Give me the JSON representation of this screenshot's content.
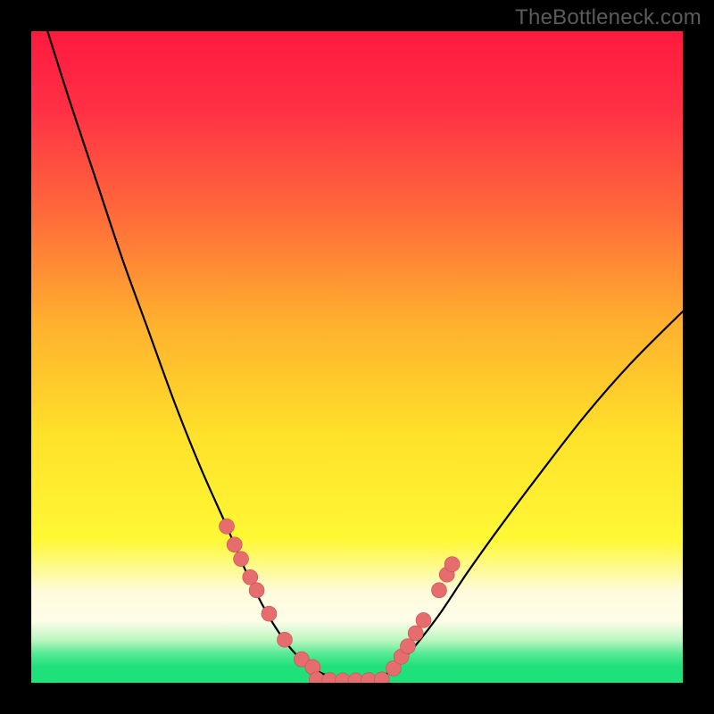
{
  "watermark": "TheBottleneck.com",
  "colors": {
    "black": "#000000",
    "curve": "#000000",
    "dot_fill": "#e56d6d",
    "dot_stroke": "#c94f4f",
    "green_band": "#1fe27b",
    "band_highlight": "#fefbdc"
  },
  "chart_data": {
    "type": "line",
    "title": "",
    "xlabel": "",
    "ylabel": "",
    "xlim": [
      0,
      100
    ],
    "ylim": [
      0,
      100
    ],
    "gradient_stops": [
      {
        "offset": 0.0,
        "color": "#ff1a3e"
      },
      {
        "offset": 0.12,
        "color": "#ff3045"
      },
      {
        "offset": 0.28,
        "color": "#ff6a3a"
      },
      {
        "offset": 0.45,
        "color": "#ffb12e"
      },
      {
        "offset": 0.62,
        "color": "#ffe12a"
      },
      {
        "offset": 0.78,
        "color": "#fff835"
      },
      {
        "offset": 0.86,
        "color": "#fefbdc"
      },
      {
        "offset": 0.905,
        "color": "#fefde8"
      },
      {
        "offset": 0.935,
        "color": "#b9f6c0"
      },
      {
        "offset": 0.955,
        "color": "#57ea95"
      },
      {
        "offset": 0.975,
        "color": "#1fe07a"
      },
      {
        "offset": 1.0,
        "color": "#1fe27b"
      }
    ],
    "series": [
      {
        "name": "left-curve",
        "x": [
          2.5,
          6,
          10,
          14,
          18,
          22,
          26,
          30,
          33,
          36,
          38.5,
          40.5,
          42.5,
          44.5,
          46.5
        ],
        "values": [
          100,
          89,
          77,
          65,
          54,
          43,
          33,
          24,
          17,
          11,
          7,
          4.5,
          2.8,
          1.5,
          0.8
        ]
      },
      {
        "name": "right-curve",
        "x": [
          53.5,
          55.5,
          57.5,
          60,
          63,
          67,
          72,
          78,
          85,
          92,
          100
        ],
        "values": [
          0.8,
          2.0,
          4.0,
          7.0,
          11,
          17,
          24,
          32,
          41,
          49,
          57
        ]
      },
      {
        "name": "flat-bottom",
        "x": [
          40.5,
          53.5
        ],
        "values": [
          0.3,
          0.3
        ]
      }
    ],
    "left_dots": {
      "x": [
        30.0,
        31.2,
        32.2,
        33.6,
        34.6,
        36.5,
        38.9,
        41.5,
        43.2
      ],
      "values": [
        24.0,
        21.2,
        19.0,
        16.2,
        14.2,
        10.6,
        6.6,
        3.6,
        2.4
      ]
    },
    "right_dots": {
      "x": [
        55.6,
        56.8,
        57.8,
        59.0,
        60.2,
        62.6,
        63.8,
        64.6
      ],
      "values": [
        2.2,
        4.0,
        5.6,
        7.6,
        9.6,
        14.2,
        16.6,
        18.2
      ]
    },
    "bottom_dots": {
      "x": [
        43.8,
        45.8,
        47.8,
        49.8,
        51.8,
        53.8
      ],
      "values": [
        0.5,
        0.4,
        0.35,
        0.35,
        0.4,
        0.5
      ]
    }
  }
}
